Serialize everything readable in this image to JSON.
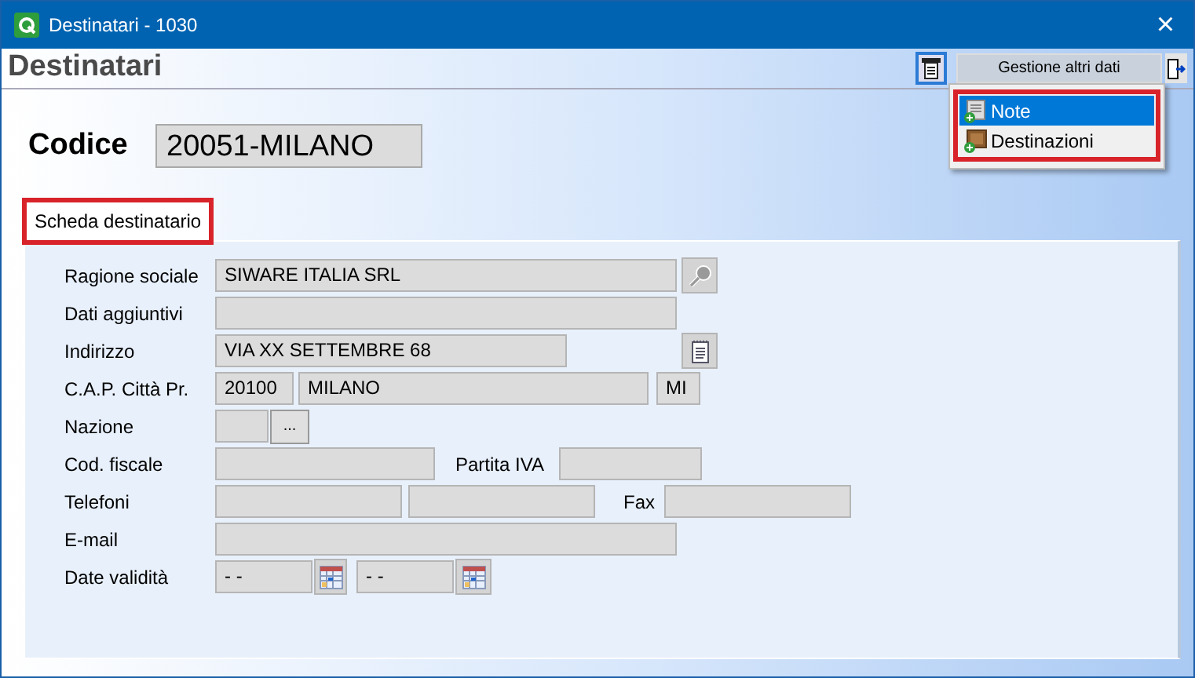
{
  "window": {
    "title": "Destinatari - 1030",
    "close": "×"
  },
  "header": {
    "title": "Destinatari",
    "menu_button": "Gestione altri dati"
  },
  "menu": [
    {
      "label": "Note",
      "selected": true
    },
    {
      "label": "Destinazioni",
      "selected": false
    }
  ],
  "code": {
    "label": "Codice",
    "value": "20051-MILANO"
  },
  "tab": {
    "label": "Scheda destinatario"
  },
  "form": [
    [
      {
        "kind": "label",
        "text": "Ragione sociale"
      },
      {
        "kind": "field",
        "value": "SIWARE ITALIA SRL"
      },
      {
        "kind": "lookup"
      }
    ],
    [
      {
        "kind": "label",
        "text": "Dati aggiuntivi"
      },
      {
        "kind": "field"
      }
    ],
    [
      {
        "kind": "label",
        "text": "Indirizzo"
      },
      {
        "kind": "field",
        "value": "VIA XX SETTEMBRE 68"
      },
      {
        "kind": "memo"
      }
    ],
    [
      {
        "kind": "label",
        "text": "C.A.P.  Città  Pr."
      },
      {
        "kind": "field",
        "value": "20100"
      },
      {
        "kind": "field",
        "value": "MILANO"
      },
      {
        "kind": "field",
        "value": "MI"
      }
    ],
    [
      {
        "kind": "label",
        "text": "Nazione"
      },
      {
        "kind": "field"
      },
      {
        "kind": "button",
        "text": "..."
      }
    ],
    [
      {
        "kind": "label",
        "text": "Cod. fiscale"
      },
      {
        "kind": "field"
      },
      {
        "kind": "label",
        "text": "Partita IVA"
      },
      {
        "kind": "field"
      }
    ],
    [
      {
        "kind": "label",
        "text": "Telefoni"
      },
      {
        "kind": "field"
      },
      {
        "kind": "field"
      },
      {
        "kind": "label",
        "text": "Fax"
      },
      {
        "kind": "field"
      }
    ],
    [
      {
        "kind": "label",
        "text": "E-mail"
      },
      {
        "kind": "field"
      }
    ],
    [
      {
        "kind": "label",
        "text": "Date validità"
      },
      {
        "kind": "field",
        "value": "- -"
      },
      {
        "kind": "calendar"
      },
      {
        "kind": "field",
        "value": "- -"
      },
      {
        "kind": "calendar"
      }
    ]
  ]
}
